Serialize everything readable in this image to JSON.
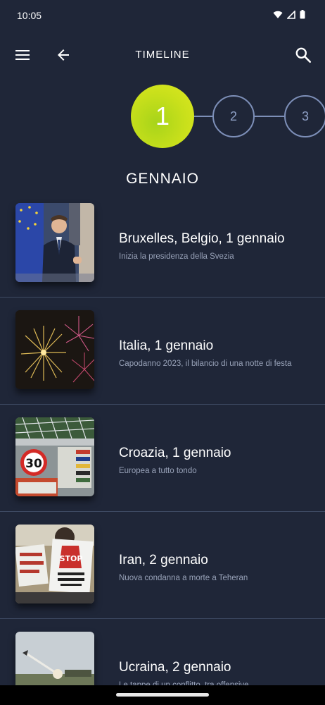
{
  "status_bar": {
    "time": "10:05",
    "icons": [
      "wifi-icon",
      "cellular-signal-icon",
      "battery-icon"
    ]
  },
  "app_bar": {
    "title": "TIMELINE",
    "left_icons": [
      "menu-icon",
      "back-arrow-icon"
    ],
    "right_icons": [
      "search-icon"
    ]
  },
  "stepper": {
    "steps": [
      {
        "label": "1",
        "active": true
      },
      {
        "label": "2",
        "active": false
      },
      {
        "label": "3",
        "active": false
      }
    ],
    "active_color": "#c9e01b",
    "inactive_color": "#7d8fb8"
  },
  "month_title": "GENNAIO",
  "items": [
    {
      "title": "Bruxelles, Belgio, 1 gennaio",
      "subtitle": "Inizia la presidenza della Svezia"
    },
    {
      "title": "Italia, 1 gennaio",
      "subtitle": "Capodanno 2023, il bilancio di una notte di festa"
    },
    {
      "title": "Croazia, 1 gennaio",
      "subtitle": "Europea a tutto tondo",
      "image_text": "30"
    },
    {
      "title": "Iran, 2 gennaio",
      "subtitle": "Nuova condanna a morte a Teheran",
      "image_text": "STOP"
    },
    {
      "title": "Ucraina, 2 gennaio",
      "subtitle": "Le tappe di un conflitto, tra offensive,"
    }
  ],
  "colors": {
    "background": "#1f2638",
    "divider": "#3e4a63",
    "subtitle": "#98a2b8"
  }
}
